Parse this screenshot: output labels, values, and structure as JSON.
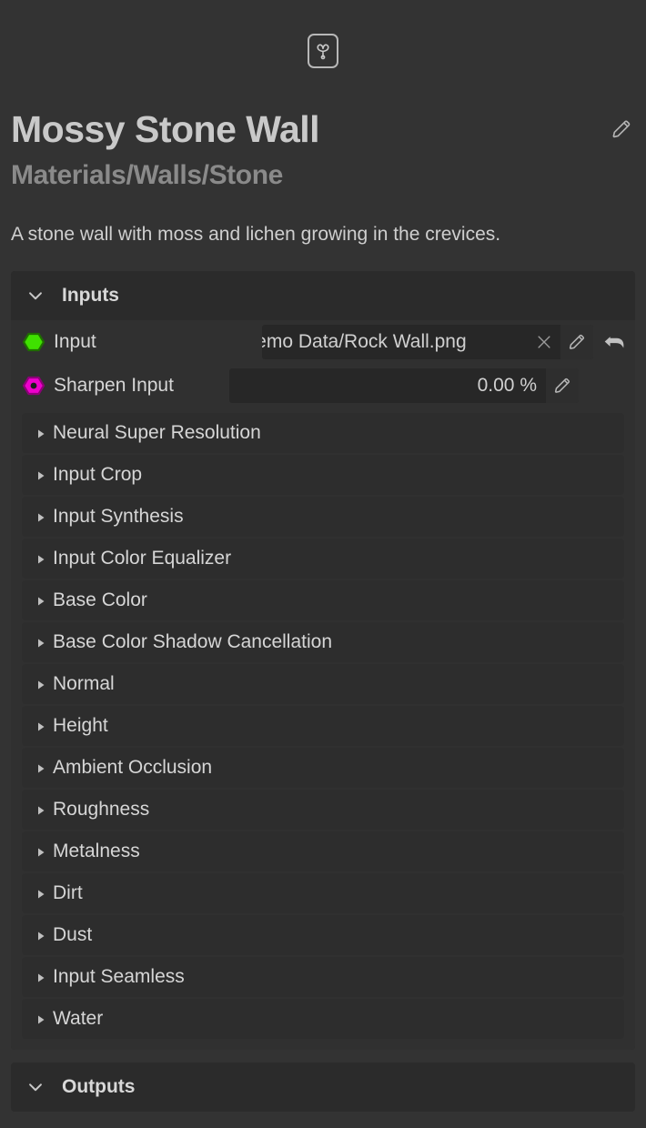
{
  "app": {
    "logo_icon": "instamat-logo-icon"
  },
  "header": {
    "title": "Mossy Stone Wall",
    "subtitle": "Materials/Walls/Stone",
    "description": "A stone wall with moss and lichen growing in the crevices.",
    "edit_icon": "pencil-icon"
  },
  "colors": {
    "page_background": "#333333",
    "panel_background": "#2b2b2b",
    "body_background": "#303030",
    "row_background": "#2d2d2d",
    "field_background": "#272727",
    "text_primary": "#d4d4d4",
    "text_secondary": "#8a8a8a",
    "input_socket_green": "#3fe000",
    "input_socket_magenta": "#ee00cc"
  },
  "sections": {
    "inputs": {
      "title": "Inputs",
      "expanded": true,
      "chevron_icon": "chevron-down-icon",
      "properties": [
        {
          "label": "Input",
          "socket_icon": "hexagon-green-icon",
          "socket_color": "#3fe000",
          "value": "Demo Data/Rock Wall.png",
          "field_type": "path",
          "clear_icon": "close-icon",
          "edit_icon": "pencil-icon",
          "reset_icon": "undo-icon"
        },
        {
          "label": "Sharpen Input",
          "socket_icon": "hexagon-magenta-icon",
          "socket_color": "#ee00cc",
          "value": "0.00 %",
          "field_type": "numeric",
          "edit_icon": "pencil-icon"
        }
      ],
      "collapsed_groups": [
        {
          "label": "Neural Super Resolution",
          "caret_icon": "caret-right-icon"
        },
        {
          "label": "Input Crop",
          "caret_icon": "caret-right-icon"
        },
        {
          "label": "Input Synthesis",
          "caret_icon": "caret-right-icon"
        },
        {
          "label": "Input Color Equalizer",
          "caret_icon": "caret-right-icon"
        },
        {
          "label": "Base Color",
          "caret_icon": "caret-right-icon"
        },
        {
          "label": "Base Color Shadow Cancellation",
          "caret_icon": "caret-right-icon"
        },
        {
          "label": "Normal",
          "caret_icon": "caret-right-icon"
        },
        {
          "label": "Height",
          "caret_icon": "caret-right-icon"
        },
        {
          "label": "Ambient Occlusion",
          "caret_icon": "caret-right-icon"
        },
        {
          "label": "Roughness",
          "caret_icon": "caret-right-icon"
        },
        {
          "label": "Metalness",
          "caret_icon": "caret-right-icon"
        },
        {
          "label": "Dirt",
          "caret_icon": "caret-right-icon"
        },
        {
          "label": "Dust",
          "caret_icon": "caret-right-icon"
        },
        {
          "label": "Input Seamless",
          "caret_icon": "caret-right-icon"
        },
        {
          "label": "Water",
          "caret_icon": "caret-right-icon"
        }
      ]
    },
    "outputs": {
      "title": "Outputs",
      "expanded": true,
      "chevron_icon": "chevron-down-icon"
    }
  }
}
